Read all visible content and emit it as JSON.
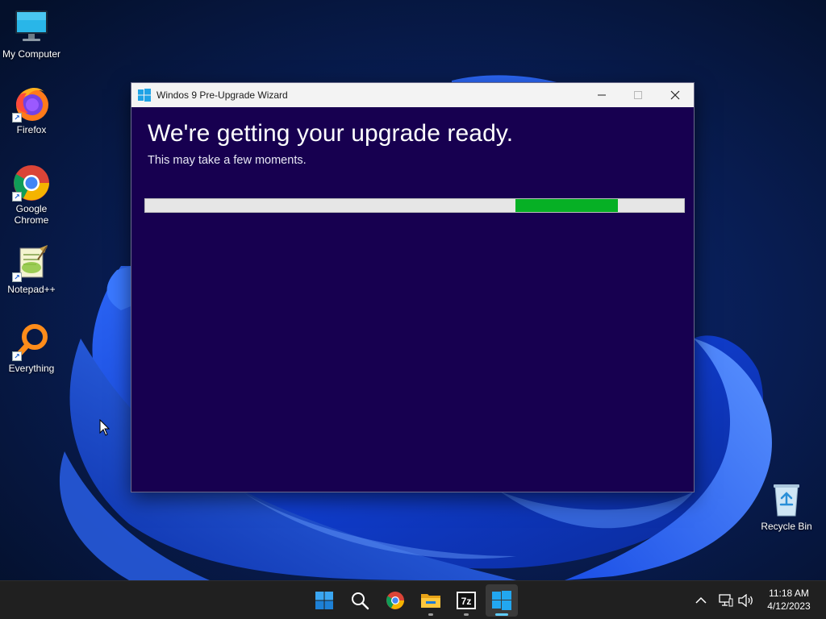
{
  "desktop": {
    "icons": [
      {
        "label": "My Computer"
      },
      {
        "label": "Firefox"
      },
      {
        "label": "Google Chrome"
      },
      {
        "label": "Notepad++"
      },
      {
        "label": "Everything"
      },
      {
        "label": "Recycle Bin"
      }
    ]
  },
  "window": {
    "title": "Windos 9 Pre-Upgrade Wizard",
    "headline": "We're getting your upgrade ready.",
    "subline": "This may take a few moments.",
    "progress": {
      "type": "marquee",
      "segment_start": 0.687,
      "segment_end": 0.877
    },
    "controls": [
      "minimize-icon",
      "maximize-icon",
      "close-icon"
    ]
  },
  "taskbar": {
    "items": [
      {
        "name": "start-button",
        "icon": "windows-logo-icon"
      },
      {
        "name": "search-button",
        "icon": "search-icon"
      },
      {
        "name": "chrome-taskbar-button",
        "icon": "chrome-icon"
      },
      {
        "name": "file-explorer-taskbar-button",
        "icon": "folder-icon"
      },
      {
        "name": "7zip-taskbar-button",
        "icon": "7zip-icon",
        "label": "7z"
      },
      {
        "name": "wizard-taskbar-button",
        "icon": "windows-logo-icon",
        "active": true
      }
    ],
    "tray": [
      "chevron-up-icon",
      "network-icon",
      "volume-icon"
    ],
    "clock": {
      "time": "11:18 AM",
      "date": "4/12/2023"
    }
  },
  "colors": {
    "window_background": "#170050",
    "progress_fill": "#06b025",
    "progress_track": "#e6e6e6",
    "taskbar": "#202020",
    "accent": "#60cdff"
  }
}
